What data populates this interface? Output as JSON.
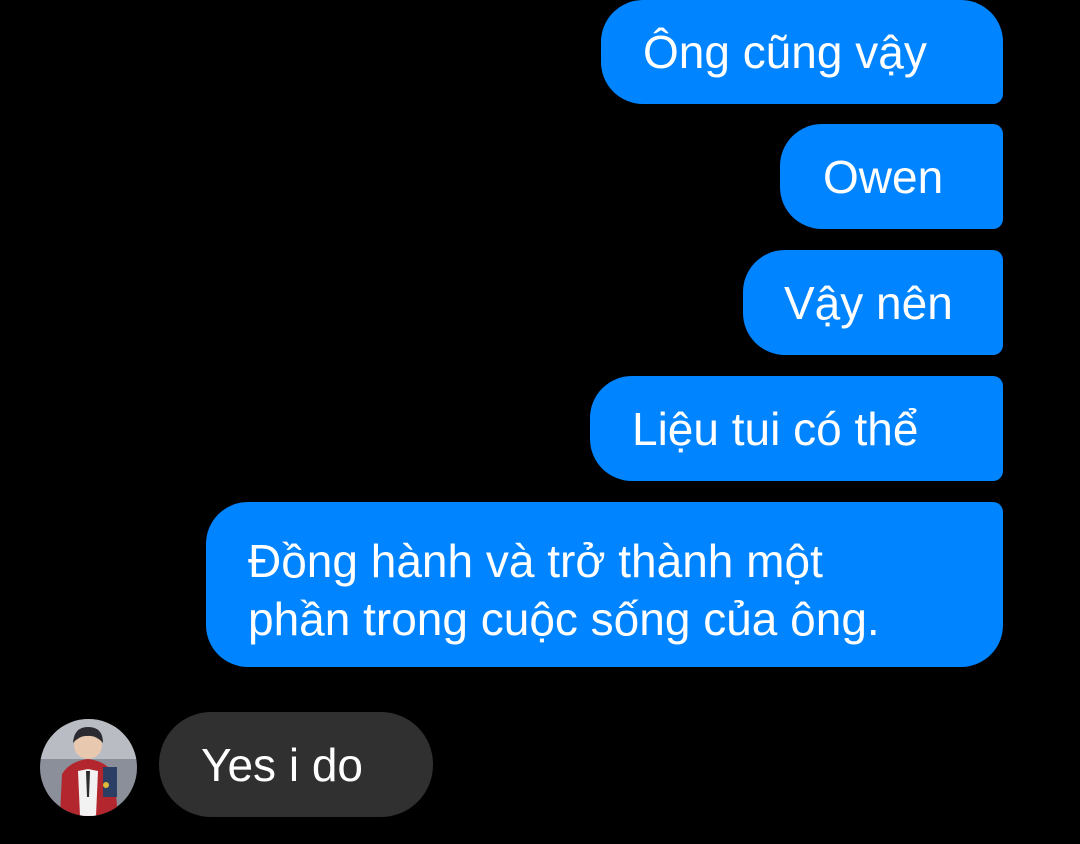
{
  "conversation": {
    "sent_messages": [
      {
        "text": "Ông cũng vậy"
      },
      {
        "text": "Owen"
      },
      {
        "text": "Vậy nên"
      },
      {
        "text": "Liệu tui có thể"
      },
      {
        "lines": [
          "Đồng hành và trở thành một",
          "phần trong cuộc sống của ông."
        ]
      }
    ],
    "received_messages": [
      {
        "text": "Yes i do"
      }
    ]
  },
  "colors": {
    "background": "#000000",
    "sent_bubble": "#0084ff",
    "received_bubble": "#303030",
    "text": "#ffffff"
  },
  "icons": {
    "avatar": "contact-avatar-photo"
  }
}
